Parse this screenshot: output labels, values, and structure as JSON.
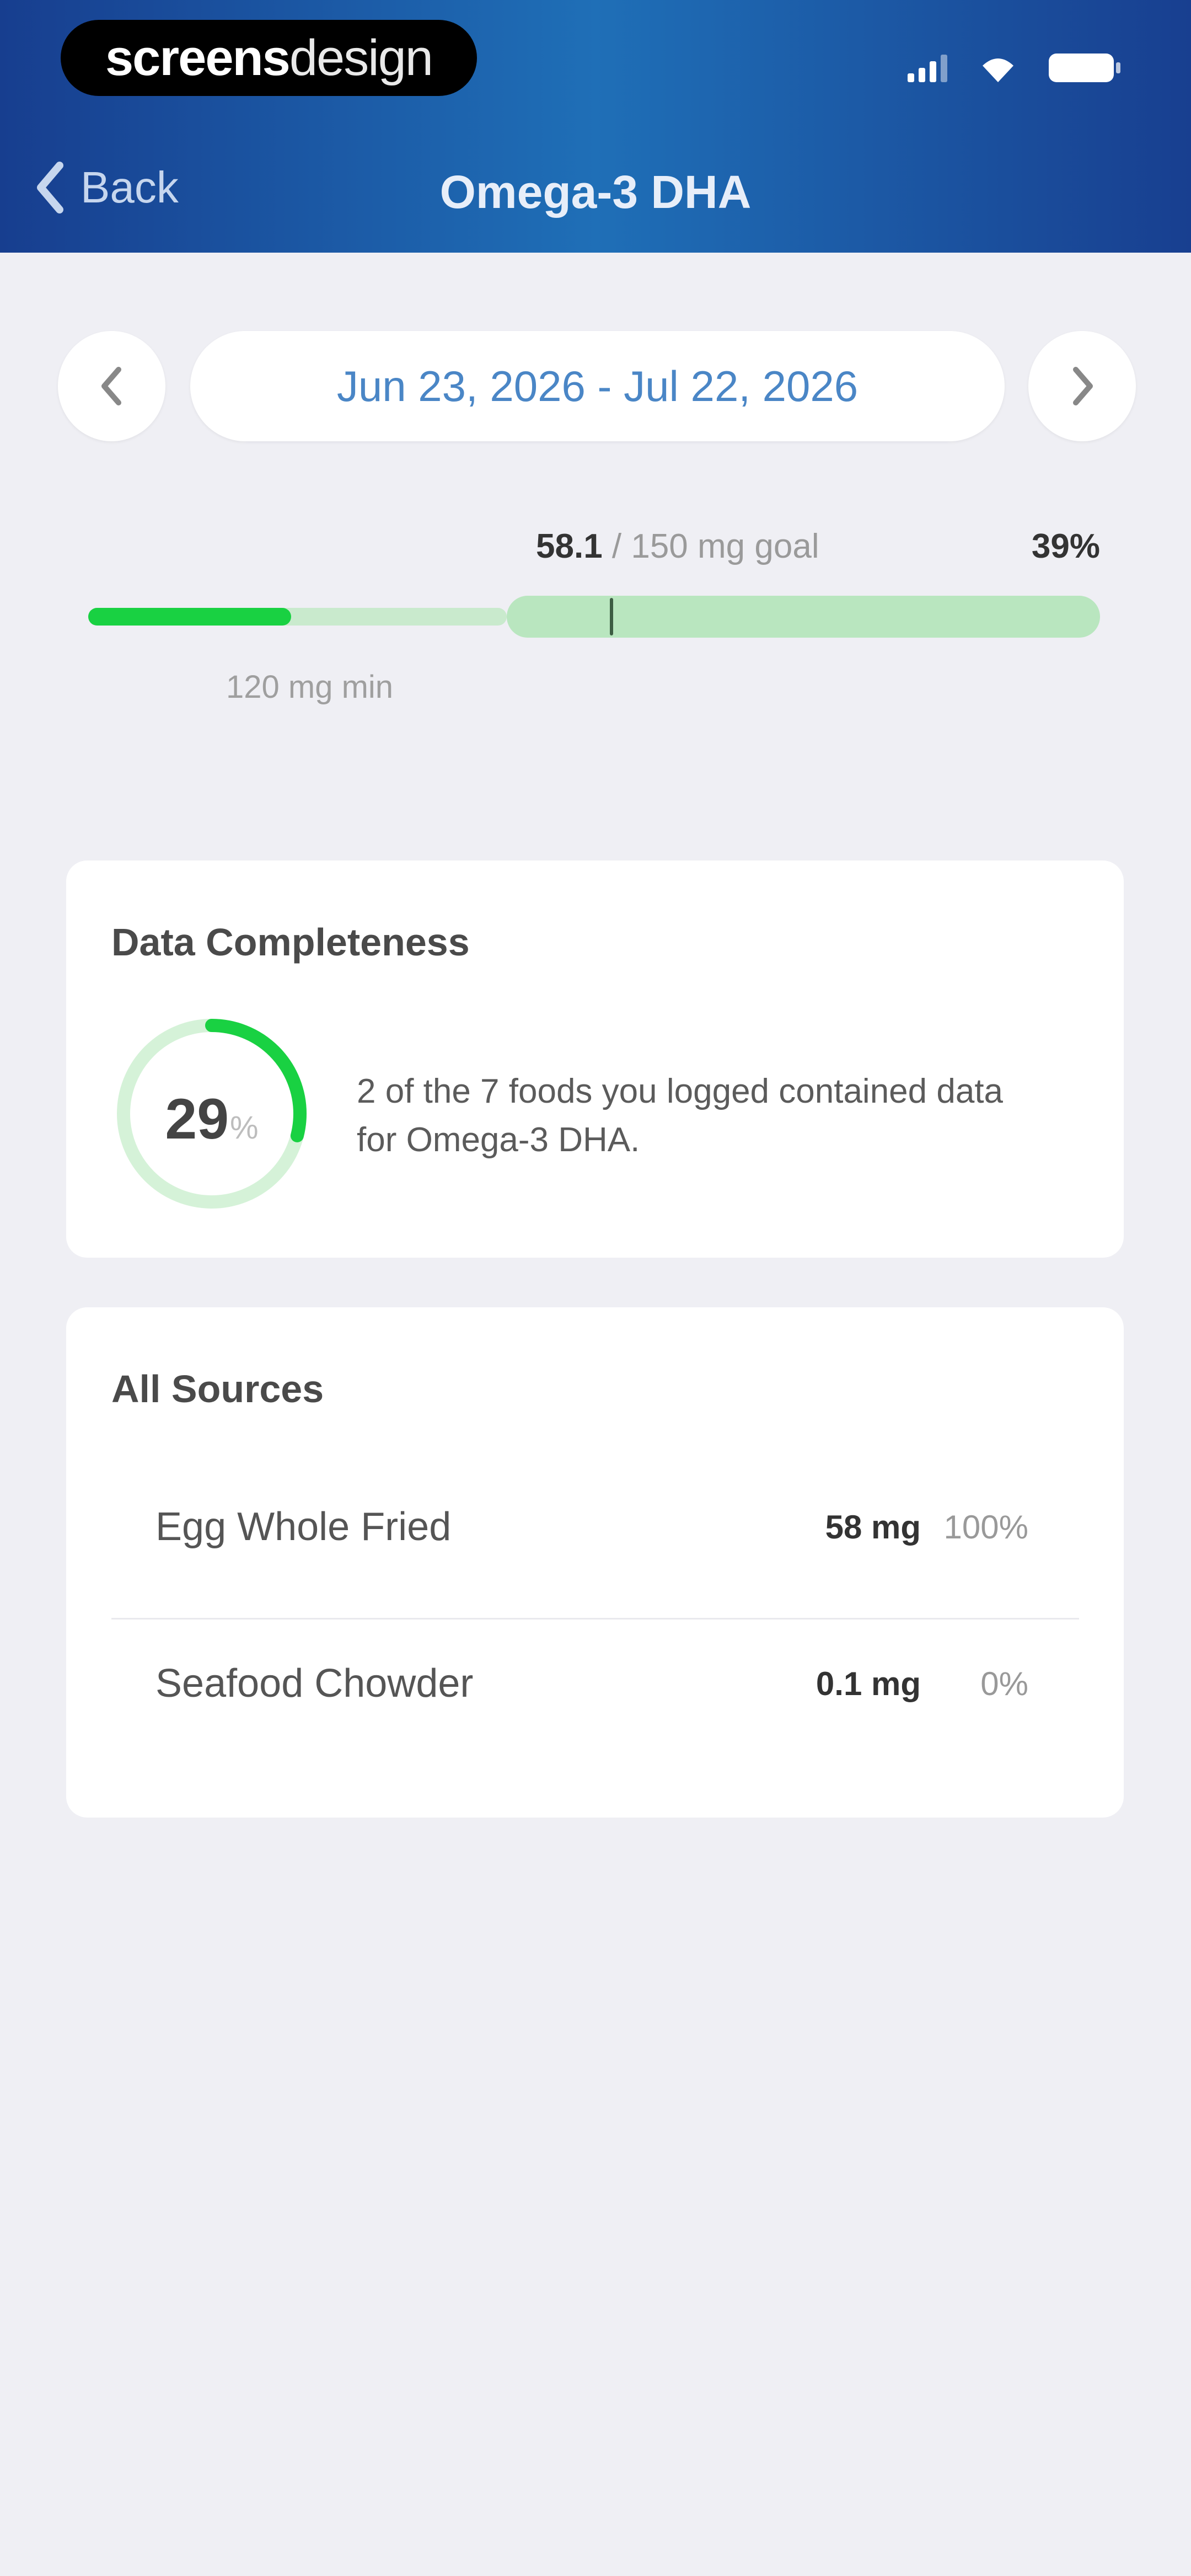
{
  "status_bar": {
    "brand_bold": "screens",
    "brand_light": "design",
    "signal_icon": "signal-icon",
    "wifi_icon": "wifi-icon",
    "battery_icon": "battery-icon"
  },
  "nav": {
    "back_label": "Back",
    "back_icon": "chevron-left-icon",
    "title": "Omega-3 DHA"
  },
  "date_range": {
    "prev_icon": "chevron-left-icon",
    "next_icon": "chevron-right-icon",
    "label": "Jun 23, 2026 - Jul 22, 2026"
  },
  "progress": {
    "current": "58.1",
    "goal_suffix": " / 150 mg goal",
    "percent": "39%",
    "min_label": "120 mg min",
    "current_value": 58.1,
    "goal_value": 150,
    "min_value": 120
  },
  "data_completeness": {
    "title": "Data Completeness",
    "percent_number": "29",
    "percent_sign": "%",
    "fraction": 0.29,
    "description": "2 of the 7 foods you logged contained data for Omega-3 DHA."
  },
  "all_sources": {
    "title": "All Sources",
    "items": [
      {
        "name": "Egg Whole Fried",
        "amount": "58 mg",
        "share": "100%"
      },
      {
        "name": "Seafood Chowder",
        "amount": "0.1 mg",
        "share": "0%"
      }
    ]
  },
  "colors": {
    "header_blue": "#1f6fb7",
    "accent_green": "#19d142",
    "light_green": "#b9e6bf",
    "date_blue": "#4a86c6"
  }
}
